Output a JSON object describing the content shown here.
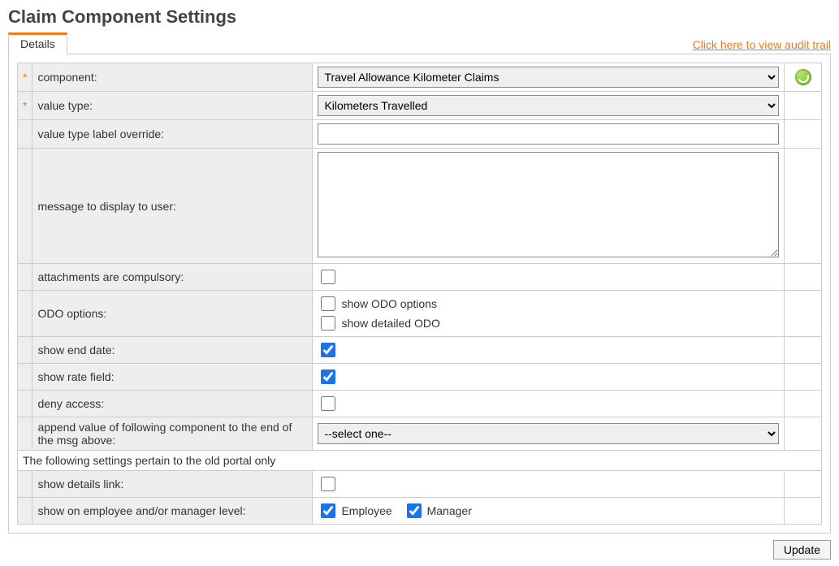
{
  "page": {
    "title": "Claim Component Settings"
  },
  "header": {
    "tab_details": "Details",
    "audit_link": "Click here to view audit trail"
  },
  "required_marker": "*",
  "fields": {
    "component": {
      "label": "component:",
      "value": "Travel Allowance Kilometer Claims"
    },
    "value_type": {
      "label": "value type:",
      "value": "Kilometers Travelled"
    },
    "value_type_label_override": {
      "label": "value type label override:",
      "value": ""
    },
    "message": {
      "label": "message to display to user:",
      "value": ""
    },
    "attachments_compulsory": {
      "label": "attachments are compulsory:",
      "checked": false
    },
    "odo_options": {
      "label": "ODO options:",
      "show_odo_label": "show ODO options",
      "show_odo_checked": false,
      "show_detailed_label": "show detailed ODO",
      "show_detailed_checked": false
    },
    "show_end_date": {
      "label": "show end date:",
      "checked": true
    },
    "show_rate_field": {
      "label": "show rate field:",
      "checked": true
    },
    "deny_access": {
      "label": "deny access:",
      "checked": false
    },
    "append_component": {
      "label": "append value of following component to the end of the msg above:",
      "value": "--select one--"
    },
    "old_portal_note": "The following settings pertain to the old portal only",
    "show_details_link": {
      "label": "show details link:",
      "checked": false
    },
    "show_on_level": {
      "label": "show on employee and/or manager level:",
      "employee_label": "Employee",
      "employee_checked": true,
      "manager_label": "Manager",
      "manager_checked": true
    }
  },
  "footer": {
    "update_label": "Update"
  }
}
